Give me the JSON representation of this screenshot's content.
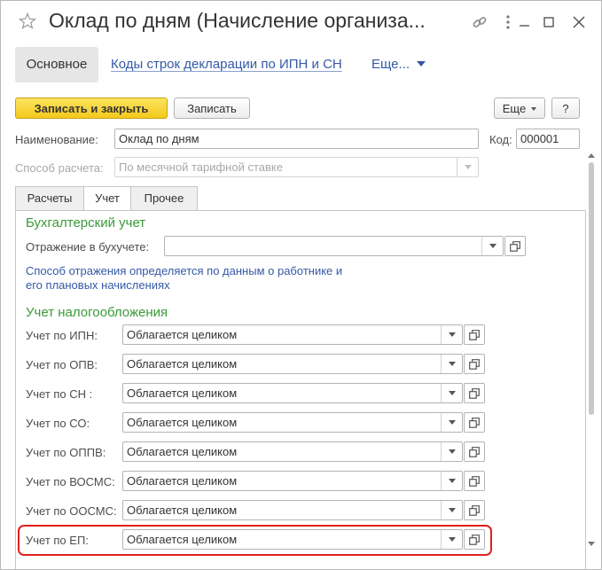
{
  "window": {
    "title": "Оклад по дням (Начисление организа...",
    "icons": [
      "star-icon",
      "link-icon",
      "more-vertical-icon",
      "minimize-icon",
      "maximize-icon",
      "close-icon"
    ]
  },
  "nav": {
    "main": "Основное",
    "link_codes": "Коды строк декларации по ИПН и СН",
    "more": "Еще..."
  },
  "toolbar": {
    "save_close": "Записать и закрыть",
    "save": "Записать",
    "more": "Еще",
    "help": "?"
  },
  "header": {
    "name_label": "Наименование:",
    "name_value": "Оклад по дням",
    "code_label": "Код:",
    "code_value": "000001",
    "method_label": "Способ расчета:",
    "method_value": "По месячной тарифной ставке"
  },
  "tabs": [
    {
      "label": "Расчеты",
      "active": false
    },
    {
      "label": "Учет",
      "active": true
    },
    {
      "label": "Прочее",
      "active": false
    }
  ],
  "accounting": {
    "title": "Бухгалтерский учет",
    "reflection_label": "Отражение в бухучете:",
    "reflection_value": "",
    "info_line1": "Способ отражения определяется по данным о работнике и",
    "info_line2": "его плановых начислениях"
  },
  "tax": {
    "title": "Учет налогообложения",
    "rows": [
      {
        "label": "Учет по ИПН:",
        "value": "Облагается целиком"
      },
      {
        "label": "Учет по ОПВ:",
        "value": "Облагается целиком"
      },
      {
        "label": "Учет по СН :",
        "value": "Облагается целиком"
      },
      {
        "label": "Учет по СО:",
        "value": "Облагается целиком"
      },
      {
        "label": "Учет по ОППВ:",
        "value": "Облагается целиком"
      },
      {
        "label": "Учет по ВОСМС:",
        "value": "Облагается целиком"
      },
      {
        "label": "Учет по ООСМС:",
        "value": "Облагается целиком"
      },
      {
        "label": "Учет по ЕП:",
        "value": "Облагается целиком"
      }
    ]
  },
  "colors": {
    "accent_link": "#3559a6",
    "section_green": "#3a9a3a",
    "primary_button": "#f3c91b",
    "highlight": "#e02020"
  }
}
